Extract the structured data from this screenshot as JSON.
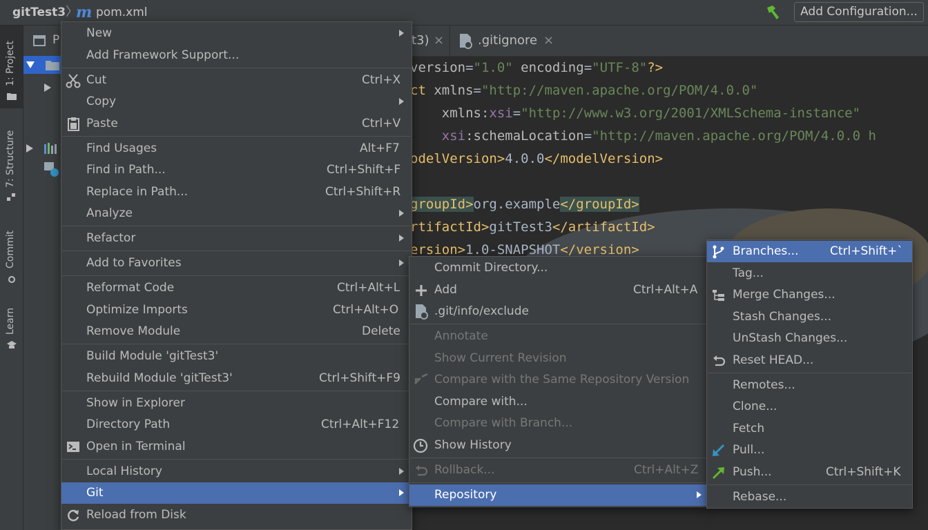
{
  "breadcrumb": {
    "project": "gitTest3",
    "separator": "〉",
    "file_icon": "m",
    "file": "pom.xml"
  },
  "toolbar": {
    "build_icon": "hammer-icon",
    "add_configuration": "Add Configuration..."
  },
  "toolstrip": {
    "project": "1: Project",
    "structure": "7: Structure",
    "commit": "Commit",
    "learn": "Learn"
  },
  "project_panel": {
    "header_letter": "P"
  },
  "tabs": [
    {
      "label": "t3)",
      "close": "×"
    },
    {
      "label": ".gitignore",
      "close": "×"
    }
  ],
  "code": {
    "l1": {
      "a": "version",
      "b": "=",
      "c": "\"1.0\"",
      "d": " encoding",
      "e": "=",
      "f": "\"UTF-8\"",
      "g": "?>"
    },
    "l2": {
      "a": "ct ",
      "b": "xmlns",
      "c": "=",
      "d": "\"http://maven.apache.org/POM/4.0.0\""
    },
    "l3": {
      "a": "    xmlns",
      "b": ":",
      "c": "xsi",
      "d": "=",
      "e": "\"http://www.w3.org/2001/XMLSchema-instance\""
    },
    "l4": {
      "a": "    xsi",
      "b": ":schemaLocation",
      "c": "=",
      "d": "\"http://maven.apache.org/POM/4.0.0 h"
    },
    "l5": {
      "a": "odelVersion>",
      "b": "4.0.0",
      "c": "</modelVersion>"
    },
    "l6": {
      "a": "groupId>",
      "b": "org.example",
      "c": "</groupId>"
    },
    "l7": {
      "a": "rtifactId>",
      "b": "gitTest3",
      "c": "</artifactId>"
    },
    "l8": {
      "a": "ersion>",
      "b": "1.0-SNAPSHOT",
      "c": "</version>"
    }
  },
  "context_menu": [
    {
      "label": "New",
      "submenu": true
    },
    {
      "label": "Add Framework Support..."
    },
    {
      "label": "Cut",
      "shortcut": "Ctrl+X",
      "icon": "scissors-icon"
    },
    {
      "label": "Copy",
      "submenu": true
    },
    {
      "label": "Paste",
      "shortcut": "Ctrl+V",
      "icon": "clipboard-icon"
    },
    {
      "label": "Find Usages",
      "shortcut": "Alt+F7"
    },
    {
      "label": "Find in Path...",
      "shortcut": "Ctrl+Shift+F"
    },
    {
      "label": "Replace in Path...",
      "shortcut": "Ctrl+Shift+R"
    },
    {
      "label": "Analyze",
      "submenu": true
    },
    {
      "label": "Refactor",
      "submenu": true
    },
    {
      "label": "Add to Favorites",
      "submenu": true
    },
    {
      "label": "Reformat Code",
      "shortcut": "Ctrl+Alt+L"
    },
    {
      "label": "Optimize Imports",
      "shortcut": "Ctrl+Alt+O"
    },
    {
      "label": "Remove Module",
      "shortcut": "Delete"
    },
    {
      "label": "Build Module 'gitTest3'"
    },
    {
      "label": "Rebuild Module 'gitTest3'",
      "shortcut": "Ctrl+Shift+F9"
    },
    {
      "label": "Show in Explorer"
    },
    {
      "label": "Directory Path",
      "shortcut": "Ctrl+Alt+F12"
    },
    {
      "label": "Open in Terminal",
      "icon": "terminal-icon"
    },
    {
      "label": "Local History",
      "submenu": true
    },
    {
      "label": "Git",
      "submenu": true,
      "selected": true
    },
    {
      "label": "Reload from Disk",
      "icon": "reload-icon"
    }
  ],
  "git_menu": [
    {
      "label": "Commit Directory..."
    },
    {
      "label": "Add",
      "shortcut": "Ctrl+Alt+A",
      "icon": "plus-icon"
    },
    {
      "label": ".git/info/exclude",
      "icon": "ignore-file-icon"
    },
    {
      "label": "Annotate",
      "disabled": true
    },
    {
      "label": "Show Current Revision",
      "disabled": true
    },
    {
      "label": "Compare with the Same Repository Version",
      "disabled": true,
      "icon": "compare-icon"
    },
    {
      "label": "Compare with..."
    },
    {
      "label": "Compare with Branch...",
      "disabled": true
    },
    {
      "label": "Show History",
      "icon": "clock-icon"
    },
    {
      "label": "Rollback...",
      "shortcut": "Ctrl+Alt+Z",
      "disabled": true,
      "icon": "rollback-icon"
    },
    {
      "label": "Repository",
      "submenu": true,
      "selected": true
    }
  ],
  "repository_menu": [
    {
      "label": "Branches...",
      "shortcut": "Ctrl+Shift+`",
      "selected": true,
      "icon": "branch-icon"
    },
    {
      "label": "Tag..."
    },
    {
      "label": "Merge Changes...",
      "icon": "merge-icon"
    },
    {
      "label": "Stash Changes..."
    },
    {
      "label": "UnStash Changes..."
    },
    {
      "label": "Reset HEAD...",
      "icon": "reset-icon"
    },
    {
      "label": "Remotes..."
    },
    {
      "label": "Clone..."
    },
    {
      "label": "Fetch"
    },
    {
      "label": "Pull...",
      "icon": "pull-arrow-icon"
    },
    {
      "label": "Push...",
      "shortcut": "Ctrl+Shift+K",
      "icon": "push-arrow-icon"
    },
    {
      "label": "Rebase..."
    }
  ],
  "colors": {
    "selection": "#4b6eaf",
    "menu_bg": "#3c3f41",
    "editor_bg": "#2b2b2b"
  }
}
